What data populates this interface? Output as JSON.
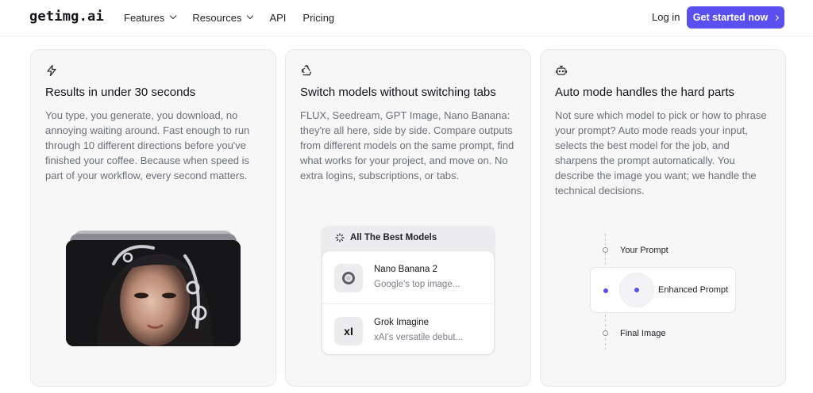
{
  "header": {
    "logo": "getimg.ai",
    "nav": [
      {
        "label": "Features",
        "dropdown": true
      },
      {
        "label": "Resources",
        "dropdown": true
      },
      {
        "label": "API",
        "dropdown": false
      },
      {
        "label": "Pricing",
        "dropdown": false
      }
    ],
    "login_label": "Log in",
    "cta_label": "Get started now"
  },
  "colors": {
    "accent": "#5b50ef",
    "card_bg": "#f7f7f8",
    "muted_text": "#6b6f78"
  },
  "cards": [
    {
      "icon": "lightning-icon",
      "title": "Results in under 30 seconds",
      "description": "You type, you generate, you download, no annoying waiting around. Fast enough to run through 10 different directions before you've finished your coffee. Because when speed is part of your workflow, every second matters."
    },
    {
      "icon": "recycle-icon",
      "title": "Switch models without switching tabs",
      "description": "FLUX, Seedream, GPT Image, Nano Banana: they're all here, side by side. Compare outputs from different models on the same prompt, find what works for your project, and move on. No extra logins, subscriptions, or tabs.",
      "models_panel": {
        "heading": "All The Best Models",
        "items": [
          {
            "name": "Nano Banana 2",
            "subtitle": "Google's top image...",
            "logo": "nano-banana-logo-icon"
          },
          {
            "name": "Grok Imagine",
            "subtitle": "xAI's versatile debut...",
            "logo_text": "xI"
          }
        ]
      }
    },
    {
      "icon": "robot-icon",
      "title": "Auto mode handles the hard parts",
      "description": "Not sure which model to pick or how to phrase your prompt? Auto mode reads your input, selects the best model for the job, and sharpens the prompt automatically. You describe the image you want; we handle the technical decisions.",
      "flow": {
        "step1": "Your Prompt",
        "step2": "Enhanced Prompt",
        "step3": "Final Image"
      }
    }
  ]
}
